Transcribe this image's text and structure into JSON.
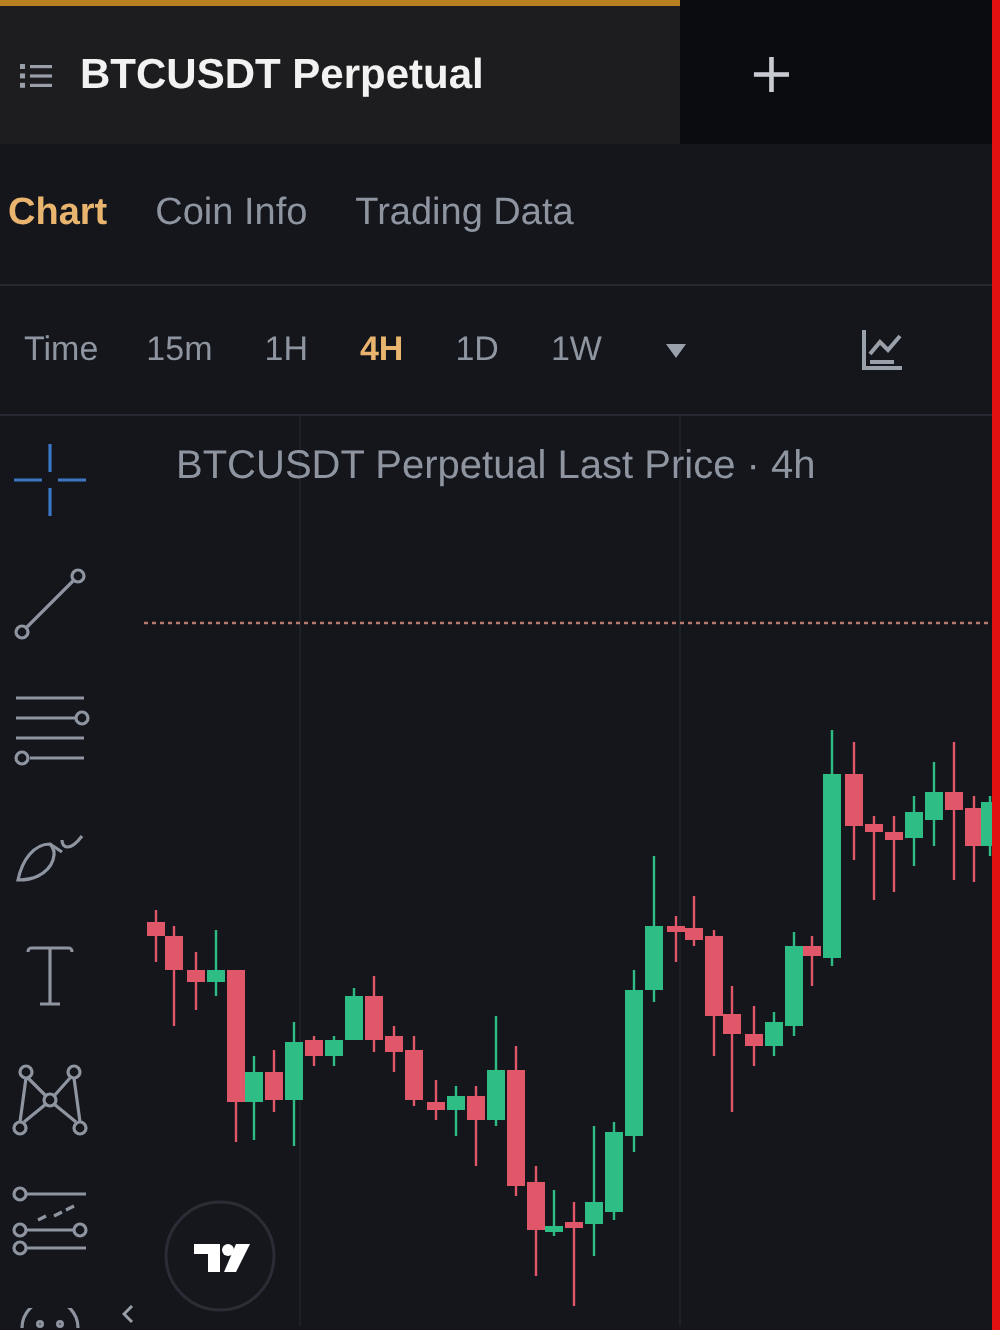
{
  "symbol_tab": {
    "title": "BTCUSDT Perpetual",
    "selected": true
  },
  "add_tab": {
    "label": "+"
  },
  "tabs": [
    {
      "label": "Chart",
      "selected": true
    },
    {
      "label": "Coin Info",
      "selected": false
    },
    {
      "label": "Trading Data",
      "selected": false
    }
  ],
  "time_label": "Time",
  "intervals": [
    {
      "label": "15m",
      "selected": false
    },
    {
      "label": "1H",
      "selected": false
    },
    {
      "label": "4H",
      "selected": true
    },
    {
      "label": "1D",
      "selected": false
    },
    {
      "label": "1W",
      "selected": false
    }
  ],
  "tools": [
    {
      "kind": "crosshair",
      "selected": true
    },
    {
      "kind": "trend-line",
      "selected": false
    },
    {
      "kind": "parallel-lines",
      "selected": false
    },
    {
      "kind": "brush",
      "selected": false
    },
    {
      "kind": "text",
      "selected": false
    },
    {
      "kind": "pattern",
      "selected": false
    },
    {
      "kind": "forecast",
      "selected": false
    },
    {
      "kind": "emoji",
      "selected": false
    }
  ],
  "chart": {
    "title": "BTCUSDT Perpetual Last Price · 4h"
  }
}
